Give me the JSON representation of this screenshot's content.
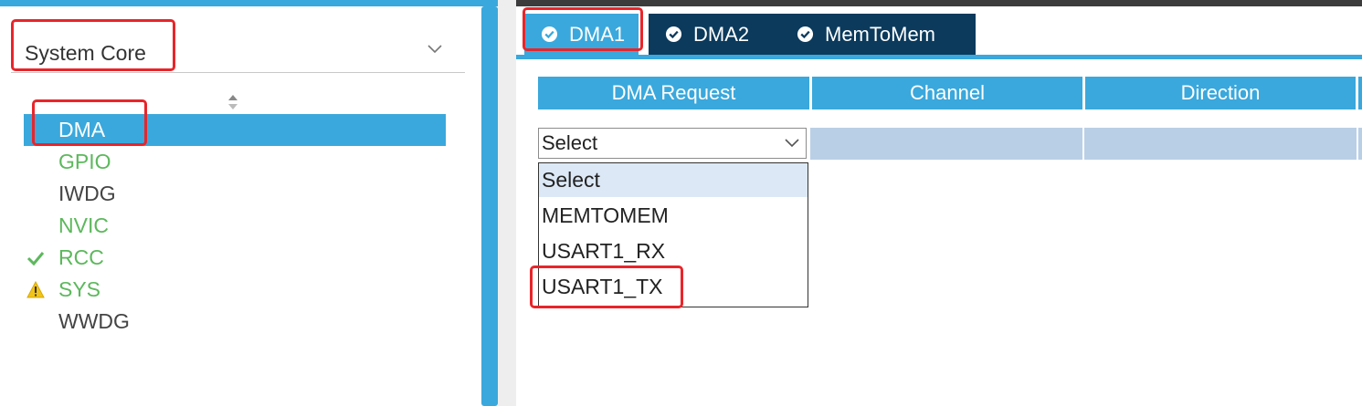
{
  "left_panel": {
    "category": "System Core",
    "peripherals": [
      {
        "label": "DMA",
        "status": "none",
        "color": "#ffffff",
        "selected": true
      },
      {
        "label": "GPIO",
        "status": "none",
        "color": "#5cb85c",
        "selected": false
      },
      {
        "label": "IWDG",
        "status": "none",
        "color": "#444444",
        "selected": false
      },
      {
        "label": "NVIC",
        "status": "none",
        "color": "#5cb85c",
        "selected": false
      },
      {
        "label": "RCC",
        "status": "check-icon",
        "color": "#5cb85c",
        "selected": false
      },
      {
        "label": "SYS",
        "status": "warning-icon",
        "color": "#5cb85c",
        "selected": false
      },
      {
        "label": "WWDG",
        "status": "none",
        "color": "#444444",
        "selected": false
      }
    ]
  },
  "tabs": [
    {
      "label": "DMA1",
      "active": true
    },
    {
      "label": "DMA2",
      "active": false
    },
    {
      "label": "MemToMem",
      "active": false
    }
  ],
  "grid": {
    "columns": [
      "DMA Request",
      "Channel",
      "Direction"
    ]
  },
  "request_select": {
    "value": "Select",
    "options": [
      "Select",
      "MEMTOMEM",
      "USART1_RX",
      "USART1_TX"
    ]
  },
  "colors": {
    "accent": "#3aa8dc",
    "tab_dark": "#0b3a5c",
    "ok_green": "#5cb85c",
    "warning": "#f0c419",
    "annotation_red": "#e8252a"
  }
}
